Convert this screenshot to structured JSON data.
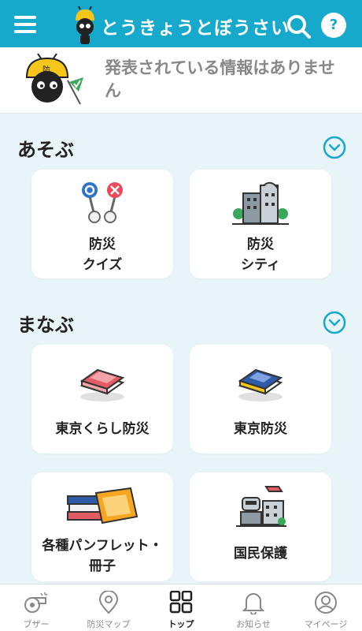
{
  "app": {
    "title": "とうきょうとぼうさい"
  },
  "header": {
    "help_label": "?"
  },
  "notice": {
    "text": "発表されている情報はありません"
  },
  "sections": [
    {
      "title": "あそぶ",
      "cards": [
        {
          "line1": "防災",
          "line2": "クイズ",
          "icon": "quiz-icon"
        },
        {
          "line1": "防災",
          "line2": "シティ",
          "icon": "city-icon"
        }
      ]
    },
    {
      "title": "まなぶ",
      "cards": [
        {
          "label": "東京くらし防災",
          "icon": "red-book-icon"
        },
        {
          "label": "東京防災",
          "icon": "blue-book-icon"
        },
        {
          "line1": "各種パンフレット・",
          "line2": "冊子",
          "icon": "pamphlets-icon"
        },
        {
          "label": "国民保護",
          "icon": "civil-protection-icon"
        }
      ]
    }
  ],
  "bottom_nav": [
    {
      "label": "ブザー",
      "icon": "whistle-icon"
    },
    {
      "label": "防災マップ",
      "icon": "map-pin-icon"
    },
    {
      "label": "トップ",
      "icon": "grid-icon",
      "active": true
    },
    {
      "label": "お知らせ",
      "icon": "bell-icon"
    },
    {
      "label": "マイページ",
      "icon": "user-icon"
    }
  ],
  "colors": {
    "primary": "#16a9cc",
    "background": "#e8f4f7"
  }
}
